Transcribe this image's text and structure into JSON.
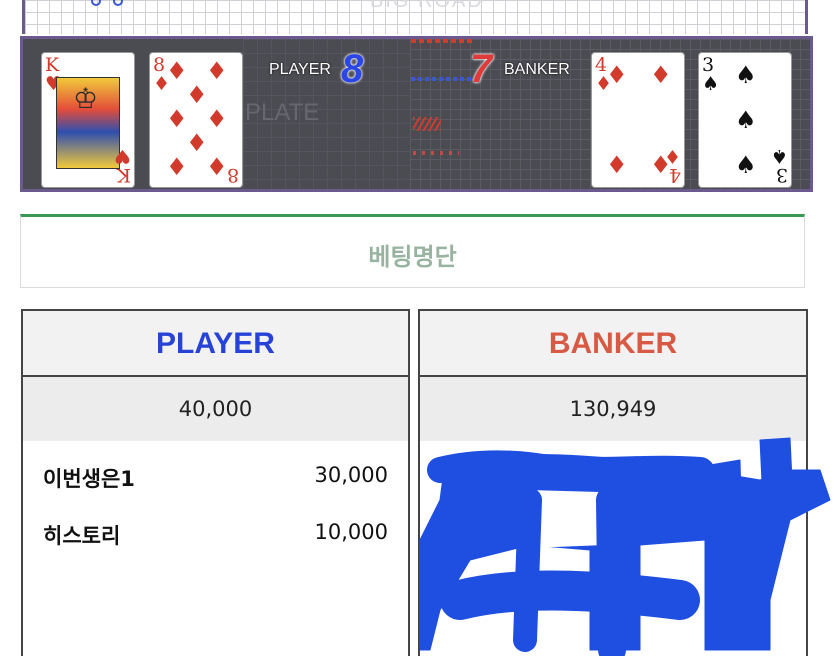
{
  "game": {
    "road_label": "BIG ROAD",
    "plate_label": "PLATE",
    "player_label": "PLAYER",
    "banker_label": "BANKER",
    "player_score": "8",
    "banker_score": "7",
    "player_cards": [
      {
        "rank": "K",
        "suit": "♥",
        "color": "red"
      },
      {
        "rank": "8",
        "suit": "♦",
        "color": "red"
      }
    ],
    "banker_cards": [
      {
        "rank": "4",
        "suit": "♦",
        "color": "red"
      },
      {
        "rank": "3",
        "suit": "♠",
        "color": "black"
      }
    ]
  },
  "bet_list": {
    "title": "베팅명단"
  },
  "player_panel": {
    "title": "PLAYER",
    "total": "40,000",
    "rows": [
      {
        "name": "이번생은1",
        "amount": "30,000"
      },
      {
        "name": "히스토리",
        "amount": "10,000"
      }
    ]
  },
  "banker_panel": {
    "title": "BANKER",
    "total": "130,949"
  },
  "colors": {
    "player": "#2742d6",
    "banker": "#d95a44",
    "accent_bar": "#3a9a53",
    "table_bg": "#4b4b52",
    "redaction": "#1f4fe0"
  },
  "icons": [
    "heart-suit-icon",
    "diamond-suit-icon",
    "spade-suit-icon"
  ]
}
